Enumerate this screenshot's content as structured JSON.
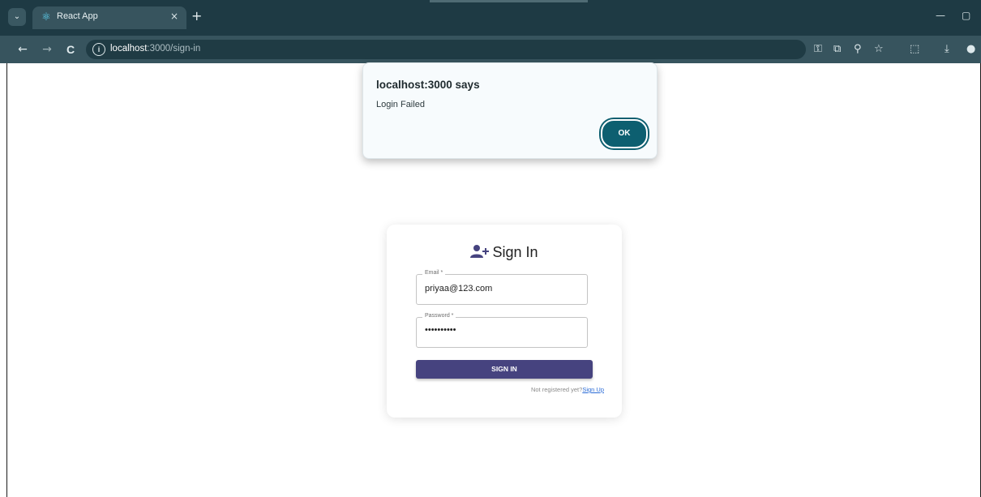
{
  "browser": {
    "tab_title": "React App",
    "tab_favicon_icon": "react-icon",
    "tab_close": "×",
    "new_tab": "+",
    "url_host": "localhost",
    "url_path": ":3000/sign-in",
    "icons": {
      "back": "←",
      "forward": "→",
      "reload": "C",
      "site_info": "i",
      "password_key": "⚿",
      "cast": "⧉",
      "zoom": "⚲",
      "bookmark": "☆",
      "extensions": "⬚",
      "download": "⤓",
      "profile": "●",
      "minimize": "—",
      "maximize": "▢",
      "tab_menu": "⌄"
    }
  },
  "alert": {
    "heading": "localhost:3000 says",
    "message": "Login Failed",
    "ok_label": "OK",
    "ok_color": "#0d5f70"
  },
  "signin": {
    "title": "Sign In",
    "email_label": "Email *",
    "email_value": "priyaa@123.com",
    "password_label": "Password *",
    "password_value": "••••••••••",
    "button_label": "SIGN IN",
    "button_color": "#46437f",
    "prompt": "Not registered yet?",
    "signup_link": "Sign Up"
  }
}
